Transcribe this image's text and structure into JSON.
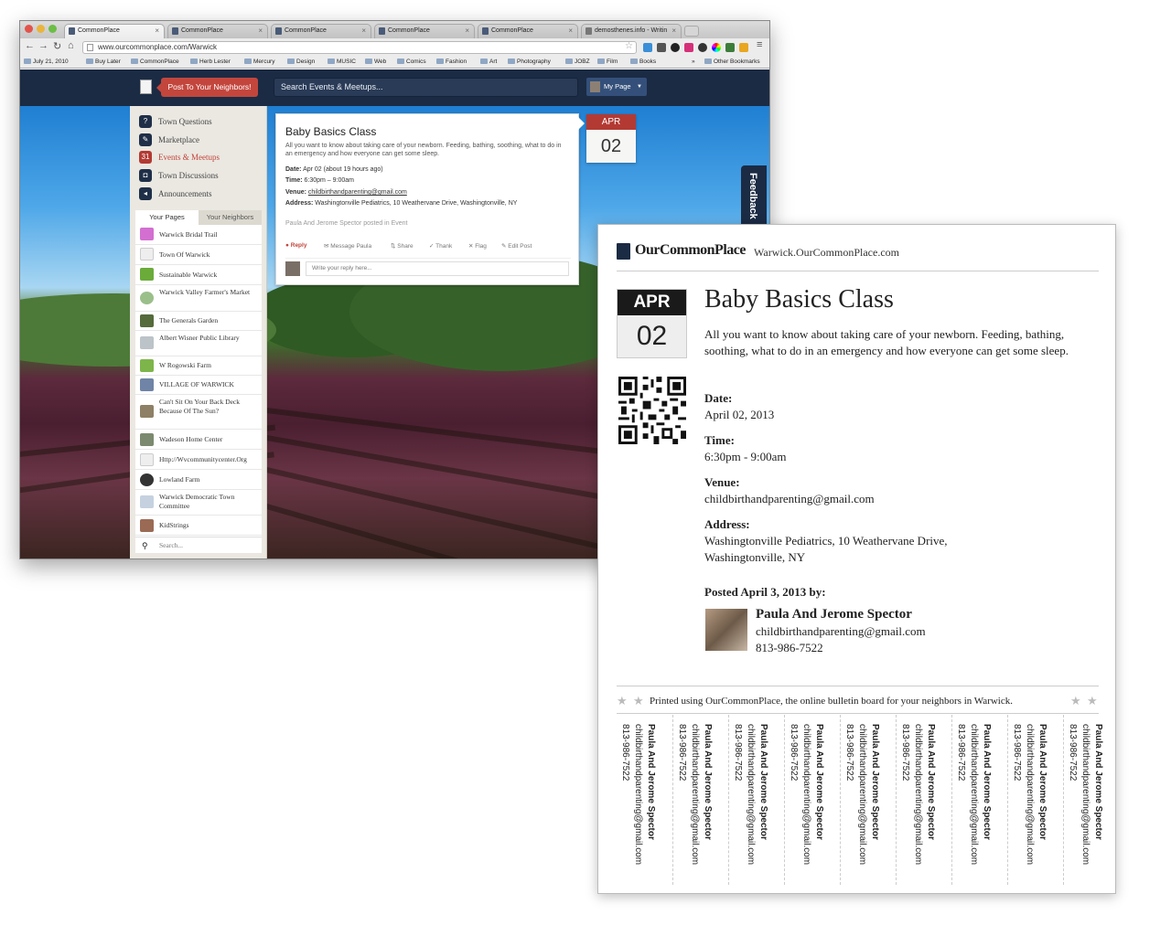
{
  "browser": {
    "tabs": [
      "CommonPlace",
      "CommonPlace",
      "CommonPlace",
      "CommonPlace",
      "CommonPlace",
      "demosthenes.info - Writin"
    ],
    "address": "www.ourcommonplace.com/Warwick",
    "bookmarks": [
      "July 21, 2010",
      "Buy Later",
      "CommonPlace",
      "Herb Lester",
      "Mercury",
      "Design",
      "MUSIC",
      "Web",
      "Comics",
      "Fashion",
      "Art",
      "Photography",
      "JOBZ",
      "Film",
      "Books"
    ],
    "bookmarks_overflow": "»",
    "other_bookmarks": "Other Bookmarks"
  },
  "header": {
    "post_button": "Post To Your Neighbors!",
    "search_placeholder": "Search Events & Meetups...",
    "my_page": "My Page"
  },
  "sidebar": {
    "nav": [
      {
        "label": "Town Questions",
        "icon": "?"
      },
      {
        "label": "Marketplace",
        "icon": "✎"
      },
      {
        "label": "Events & Meetups",
        "icon": "31"
      },
      {
        "label": "Town Discussions",
        "icon": "◘"
      },
      {
        "label": "Announcements",
        "icon": "◂"
      }
    ],
    "tabs": [
      "Your Pages",
      "Your Neighbors"
    ],
    "pages": [
      "Warwick Bridal Trail",
      "Town Of Warwick",
      "Sustainable Warwick",
      "Warwick Valley Farmer's Market",
      "The Generals Garden",
      "Albert Wisner Public Library",
      "W Rogowski Farm",
      "VILLAGE OF WARWICK",
      "Can't Sit On Your Back Deck Because Of The Sun?",
      "Wadeson Home Center",
      "Http://Wvcommunitycenter.Org",
      "Lowland Farm",
      "Warwick Democratic Town Committee",
      "KidStrings"
    ],
    "search_placeholder": "Search..."
  },
  "event": {
    "title": "Baby Basics Class",
    "description": "All you want to know about taking care of your newborn. Feeding, bathing, soothing, what to do in an emergency and how everyone can get some sleep.",
    "date_label": "Date:",
    "date_value": "Apr 02 (about 19 hours ago)",
    "time_label": "Time:",
    "time_value": "6:30pm – 9:00am",
    "venue_label": "Venue:",
    "venue_value": "childbirthandparenting@gmail.com",
    "address_label": "Address:",
    "address_value": "Washingtonville Pediatrics, 10 Weathervane Drive, Washingtonville, NY",
    "posted_by": "Paula And Jerome Spector posted in Event",
    "actions": [
      "Reply",
      "Message Paula",
      "Share",
      "Thank",
      "Flag",
      "Edit Post"
    ],
    "reply_placeholder": "Write your reply here...",
    "badge_month": "APR",
    "badge_day": "02",
    "feedback_tab": "Feedback"
  },
  "flyer": {
    "brand": "OurCommonPlace",
    "site": "Warwick.OurCommonPlace.com",
    "month": "APR",
    "day": "02",
    "title": "Baby Basics Class",
    "description": "All you want to know about taking care of your newborn. Feeding, bathing, soothing, what to do in an emergency and how everyone can get some sleep.",
    "date_label": "Date:",
    "date_value": "April 02, 2013",
    "time_label": "Time:",
    "time_value": "6:30pm - 9:00am",
    "venue_label": "Venue:",
    "venue_value": "childbirthandparenting@gmail.com",
    "address_label": "Address:",
    "address_value": "Washingtonville Pediatrics, 10 Weathervane Drive, Washingtonville, NY",
    "posted_label": "Posted April 3, 2013 by:",
    "poster_name": "Paula And Jerome Spector",
    "poster_email": "childbirthandparenting@gmail.com",
    "poster_phone": "813-986-7522",
    "printed_note": "Printed using OurCommonPlace, the online bulletin board for your neighbors in Warwick.",
    "tearoff": {
      "name": "Paula And Jerome Spector",
      "email": "childbirthandparenting@gmail.com",
      "phone": "813-986-7522"
    }
  }
}
